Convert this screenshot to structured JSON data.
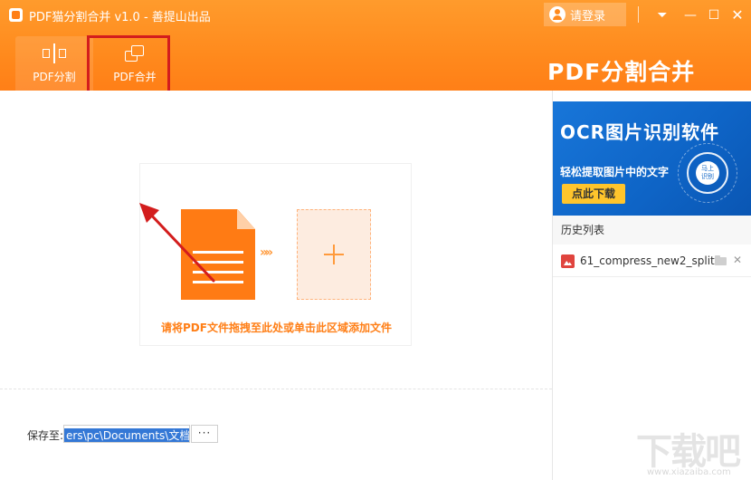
{
  "window": {
    "title": "PDF猫分割合并 v1.0 - 善提山出品",
    "login_label": "请登录",
    "menu_glyph": "⏷",
    "min_glyph": "—",
    "max_glyph": "☐",
    "close_glyph": "✕"
  },
  "tabs": [
    {
      "label": "PDF分割",
      "icon": "split-icon"
    },
    {
      "label": "PDF合并",
      "icon": "merge-icon"
    }
  ],
  "brand_text": "PDF分割合并",
  "drop_zone": {
    "hint": "请将PDF文件拖拽至此处或单击此区域添加文件",
    "arrows": "»»"
  },
  "save": {
    "label": "保存至:",
    "path": "ers\\pc\\Documents\\文档",
    "browse_label": "···"
  },
  "ad": {
    "title": "OCR图片识别软件",
    "subtitle": "轻松提取图片中的文字",
    "button": "点此下载",
    "badge_line1": "马上",
    "badge_line2": "识别"
  },
  "history": {
    "title": "历史列表",
    "items": [
      {
        "name": "61_compress_new2_split"
      }
    ],
    "remove_glyph": "✕"
  },
  "watermark": {
    "text": "下载吧",
    "url": "www.xiazaiba.com"
  },
  "colors": {
    "header_orange": "#ff8a1d",
    "accent_orange": "#ff7f17",
    "highlight_red": "#d31d1d",
    "ad_blue": "#0e64c6",
    "ad_button_yellow": "#ffc52c"
  }
}
